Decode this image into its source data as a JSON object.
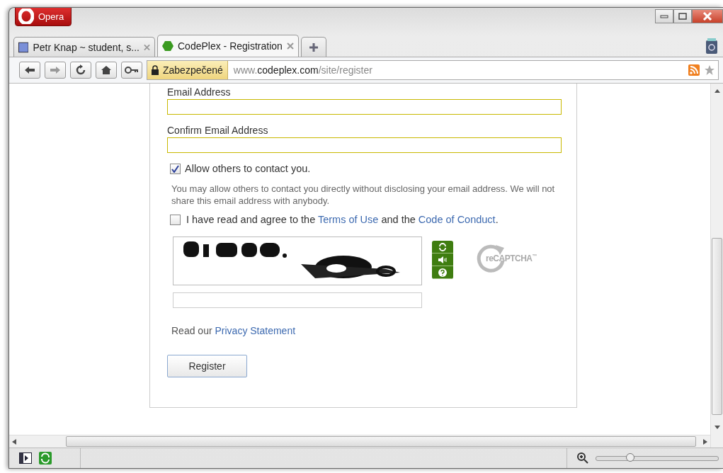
{
  "browser": {
    "menu_button": "Opera",
    "tabs": [
      {
        "title": "Petr Knap ~ student, s...",
        "selected": false,
        "kind": "square"
      },
      {
        "title": "CodePlex - Registration",
        "selected": true,
        "kind": "hexagon"
      }
    ]
  },
  "address_bar": {
    "security_label": "Zabezpečené",
    "url": "www.**codeplex.com**/site/register"
  },
  "form": {
    "fields": [
      {
        "label": "Email Address"
      },
      {
        "label": "Confirm Email Address"
      }
    ],
    "contact_option": {
      "label": "Allow others to contact you.",
      "checked": true
    },
    "contact_note": "You may allow others to contact you directly without disclosing your email address. We will not share this email address with anybody.",
    "terms": {
      "checked": false,
      "before": "I have read and agree to the ",
      "terms_link": "Terms of Use",
      "middle": " and the ",
      "conduct_link": "Code of Conduct",
      "after": "."
    },
    "captcha": {
      "logo": "reCAPTCHA",
      "logo_mark": "™"
    },
    "privacy": {
      "text": "Read our ",
      "link": "Privacy Statement"
    },
    "submit": "Register"
  },
  "status_bar": {
    "zoom": {
      "level": 0.28
    }
  }
}
